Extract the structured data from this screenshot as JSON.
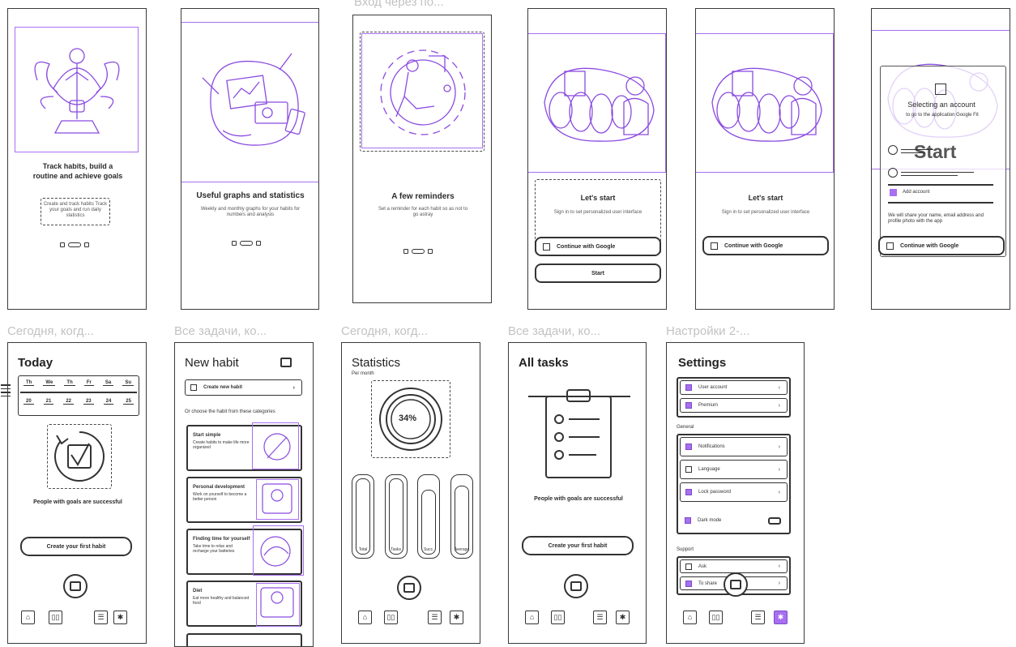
{
  "frame_titles": [
    "Вход через по...",
    "Сегодня, когд...",
    "Все задачи, ко...",
    "Сегодня, когд...",
    "Все задачи, ко...",
    "Настройки 2-..."
  ],
  "onboarding": {
    "screen1": {
      "title": "Track habits, build a routine and achieve goals",
      "subtitle": "Create and track habits Track your goals and run daily statistics"
    },
    "screen2": {
      "title": "Useful graphs and statistics",
      "subtitle": "Weekly and monthly graphs for your habits for numbers and analysis"
    },
    "screen3": {
      "title": "A few reminders",
      "subtitle": "Set a reminder for each habit so as not to go astray"
    }
  },
  "login": {
    "title": "Let's start",
    "subtitle": "Sign in to set personalized user interface",
    "google_button": "Continue with Google",
    "start_button": "Start",
    "picker_title": "Selecting an account",
    "picker_sub": "to go to the application Google Fit",
    "overlay_start": "Start",
    "add_account": "Add account",
    "picker_note": "We will share your name, email address and profile photo with the app"
  },
  "today": {
    "title": "Today",
    "days": [
      "Th",
      "We",
      "Th",
      "Fr",
      "Sa",
      "Su"
    ],
    "dates": [
      "20",
      "21",
      "22",
      "23",
      "24",
      "25"
    ],
    "motto": "People with goals are successful",
    "create_button": "Create your first habit"
  },
  "new_habit": {
    "title": "New habit",
    "create_row": "Create new habit",
    "choose_text": "Or choose the habit from these categories",
    "categories": [
      {
        "title": "Start simple",
        "desc": "Create habits to make life more organized"
      },
      {
        "title": "Personal development",
        "desc": "Work on yourself to become a better person"
      },
      {
        "title": "Finding time for yourself",
        "desc": "Take time to relax and recharge your batteries"
      },
      {
        "title": "Diet",
        "desc": "Eat more healthy and balanced food"
      }
    ]
  },
  "statistics": {
    "title": "Statistics",
    "period": "Per month",
    "percent": "34%",
    "bar_labels": [
      "Total",
      "Tasks",
      "Succ.",
      "Average"
    ]
  },
  "all_tasks": {
    "title": "All tasks",
    "motto": "People with goals are successful",
    "create_button": "Create your first habit"
  },
  "settings": {
    "title": "Settings",
    "account_rows": [
      "User account",
      "Premium"
    ],
    "general_label": "General",
    "general_rows": [
      "Notifications",
      "Language",
      "Lock password",
      "Dark mode"
    ],
    "support_label": "Support",
    "support_rows": [
      "Ask",
      "To share"
    ]
  },
  "nav_icons": [
    "home-icon",
    "stats-icon",
    "list-icon",
    "gear-icon"
  ],
  "colors": {
    "accent": "#a86ff0",
    "stroke": "#333333",
    "frame_title": "#c2c2c2"
  }
}
